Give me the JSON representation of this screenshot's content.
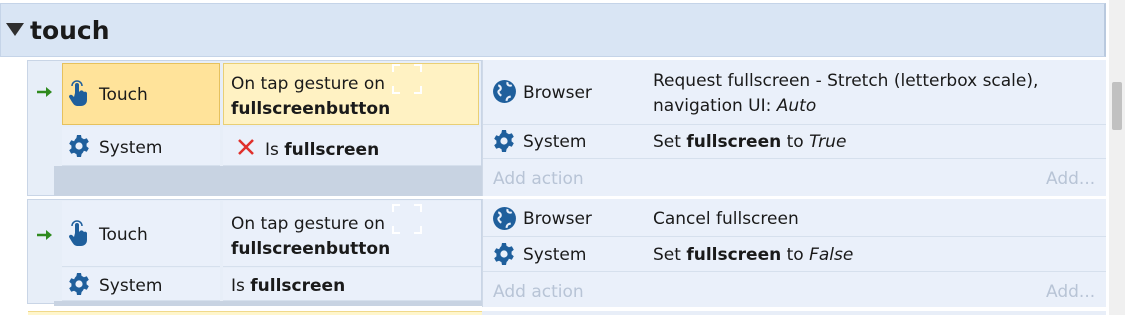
{
  "group": {
    "title": "touch"
  },
  "blocks": [
    {
      "conditions": [
        {
          "object": "Touch",
          "text_pre": "On tap gesture on",
          "text_bold": "fullscreenbutton",
          "selected": true,
          "trigger": true
        },
        {
          "object": "System",
          "inverted": true,
          "text_pre": "Is ",
          "text_bold": "fullscreen"
        }
      ],
      "actions": [
        {
          "object": "Browser",
          "line1": "Request fullscreen - Stretch (letterbox scale),",
          "line2_pre": "navigation UI: ",
          "line2_italic": "Auto"
        },
        {
          "object": "System",
          "pre": "Set ",
          "bold": "fullscreen",
          "mid": " to ",
          "italic": "True"
        }
      ],
      "add_action": "Add action",
      "add_short": "Add..."
    },
    {
      "conditions": [
        {
          "object": "Touch",
          "text_pre": "On tap gesture on",
          "text_bold": "fullscreenbutton",
          "trigger": true
        },
        {
          "object": "System",
          "text_pre": "Is ",
          "text_bold": "fullscreen"
        }
      ],
      "actions": [
        {
          "object": "Browser",
          "text": "Cancel fullscreen"
        },
        {
          "object": "System",
          "pre": "Set ",
          "bold": "fullscreen",
          "mid": " to ",
          "italic": "False"
        }
      ],
      "add_action": "Add action",
      "add_short": "Add..."
    }
  ],
  "colors": {
    "header_bg": "#d9e5f4",
    "selected_object": "#ffe39a",
    "selected_condition": "#fff2c3",
    "trigger_arrow": "#2f8a1e",
    "invert_x": "#e0302b",
    "icon_blue": "#1f5f9c"
  },
  "icons": {
    "touch": "hand-pointer-icon",
    "system": "gear-icon",
    "browser": "globe-icon",
    "invert": "x-icon",
    "trigger": "arrow-right-icon"
  }
}
